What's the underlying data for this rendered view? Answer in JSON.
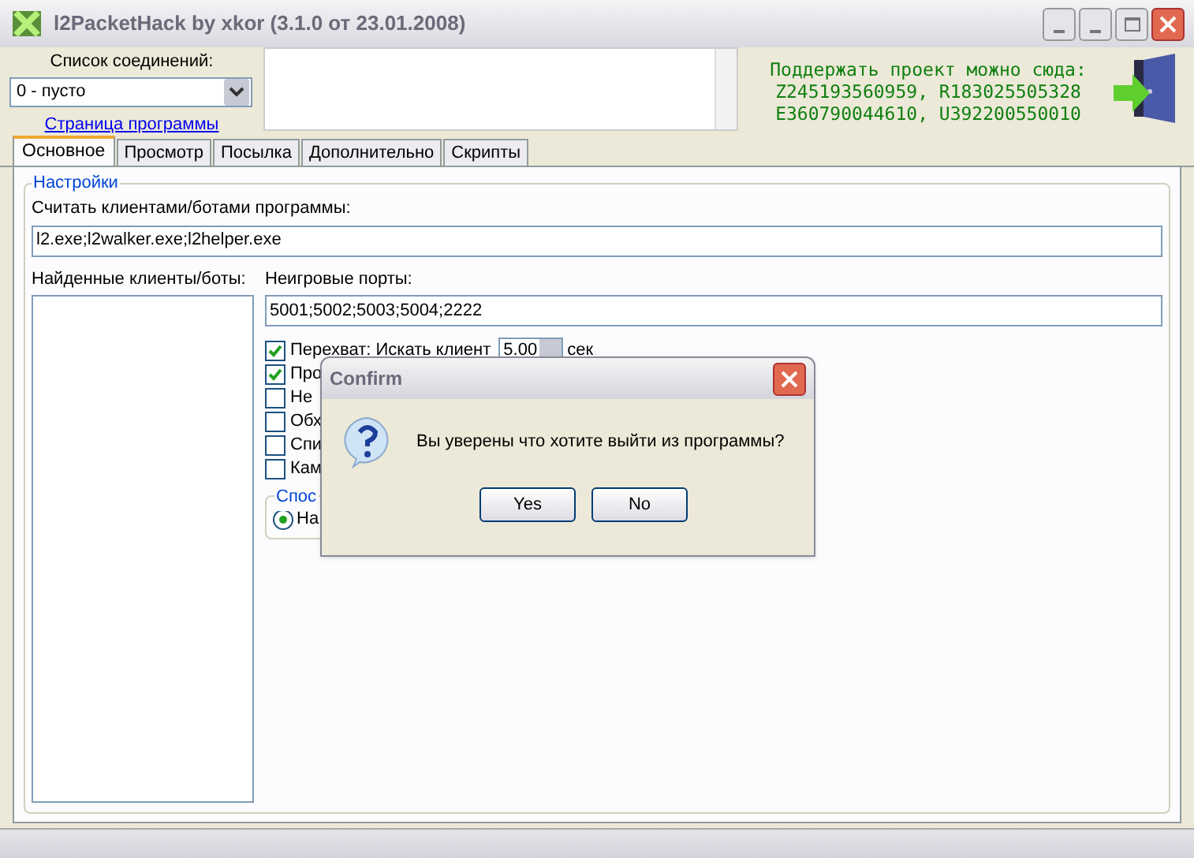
{
  "window": {
    "title": "l2PacketHack by xkor (3.1.0 от 23.01.2008)"
  },
  "connections": {
    "label": "Список соединений:",
    "value": "0 - пусто",
    "link": "Страница программы"
  },
  "donate": {
    "lines": [
      "Поддержать проект можно сюда:",
      "Z245193560959, R183025505328",
      "E360790044610, U392200550010"
    ]
  },
  "tabs": [
    {
      "label": "Основное",
      "selected": true
    },
    {
      "label": "Просмотр",
      "selected": false
    },
    {
      "label": "Посылка",
      "selected": false
    },
    {
      "label": "Дополнительно",
      "selected": false
    },
    {
      "label": "Скрипты",
      "selected": false
    }
  ],
  "settings": {
    "title": "Настройки",
    "programs_label": "Считать клиентами/ботами программы:",
    "programs_value": "l2.exe;l2walker.exe;l2helper.exe",
    "found_label": "Найденные клиенты/боты:",
    "ports_label": "Неигровые порты:",
    "ports_value": "5001;5002;5003;5004;2222",
    "options": [
      {
        "label": "Перехват: Искать клиент",
        "checked": true,
        "spin": "5.00",
        "unit": "сек"
      },
      {
        "label": "Про",
        "checked": true
      },
      {
        "label": "Не",
        "checked": false
      },
      {
        "label": "Обх",
        "checked": false
      },
      {
        "label": "Спи",
        "checked": false
      },
      {
        "label": "Кам",
        "checked": false
      }
    ],
    "method": {
      "title": "Спос",
      "radio": {
        "label": "На",
        "selected": true
      }
    }
  },
  "dialog": {
    "title": "Confirm",
    "message": "Вы уверены что хотите выйти из программы?",
    "buttons": [
      "Yes",
      "No"
    ]
  }
}
